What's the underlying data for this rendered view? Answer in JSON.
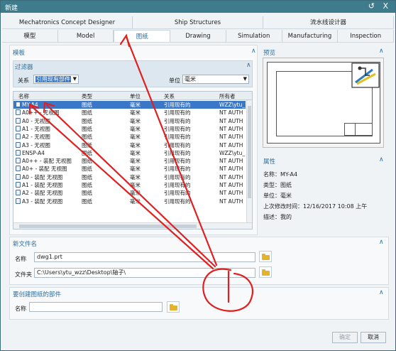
{
  "window": {
    "title": "新建",
    "controls": "↺ X"
  },
  "app_tabs": [
    "Mechatronics Concept Designer",
    "Ship Structures",
    "流水线设计器"
  ],
  "tabs": [
    {
      "label": "模型",
      "active": false
    },
    {
      "label": "Model",
      "active": false
    },
    {
      "label": "图纸",
      "active": true
    },
    {
      "label": "Drawing",
      "active": false
    },
    {
      "label": "Simulation",
      "active": false
    },
    {
      "label": "Manufacturing",
      "active": false
    },
    {
      "label": "Inspection",
      "active": false
    }
  ],
  "templates": {
    "title": "模板",
    "filter_title": "过滤器",
    "relation_label": "关系",
    "relation_value": "引用现有部件",
    "unit_label": "单位",
    "unit_value": "毫米",
    "columns": [
      "名称",
      "类型",
      "单位",
      "关系",
      "所有者"
    ],
    "rows": [
      {
        "name": "MY-A4",
        "type": "图纸",
        "unit": "毫米",
        "rel": "引用现有的",
        "owner": "WZZ\\ytu_"
      },
      {
        "name": "A0++ - 无视图",
        "type": "图纸",
        "unit": "毫米",
        "rel": "引用现有的",
        "owner": "NT AUTH"
      },
      {
        "name": "A0 - 无视图",
        "type": "图纸",
        "unit": "毫米",
        "rel": "引用现有的",
        "owner": "NT AUTH"
      },
      {
        "name": "A1 - 无视图",
        "type": "图纸",
        "unit": "毫米",
        "rel": "引用现有的",
        "owner": "NT AUTH"
      },
      {
        "name": "A2 - 无视图",
        "type": "图纸",
        "unit": "毫米",
        "rel": "引用现有的",
        "owner": "NT AUTH"
      },
      {
        "name": "A3 - 无视图",
        "type": "图纸",
        "unit": "毫米",
        "rel": "引用现有的",
        "owner": "NT AUTH"
      },
      {
        "name": "ENSP-A4",
        "type": "图纸",
        "unit": "毫米",
        "rel": "引用现有的",
        "owner": "WZZ\\ytu_"
      },
      {
        "name": "A0++ - 装配 无视图",
        "type": "图纸",
        "unit": "毫米",
        "rel": "引用现有的",
        "owner": "NT AUTH"
      },
      {
        "name": "A0+ - 装配 无视图",
        "type": "图纸",
        "unit": "毫米",
        "rel": "引用现有的",
        "owner": "NT AUTH"
      },
      {
        "name": "A0 - 装配 无视图",
        "type": "图纸",
        "unit": "毫米",
        "rel": "引用现有的",
        "owner": "NT AUTH"
      },
      {
        "name": "A1 - 装配 无视图",
        "type": "图纸",
        "unit": "毫米",
        "rel": "引用现有的",
        "owner": "NT AUTH"
      },
      {
        "name": "A2 - 装配 无视图",
        "type": "图纸",
        "unit": "毫米",
        "rel": "引用现有的",
        "owner": "NT AUTH"
      },
      {
        "name": "A3 - 装配 无视图",
        "type": "图纸",
        "unit": "毫米",
        "rel": "引用现有的",
        "owner": "NT AUTH"
      }
    ]
  },
  "preview": {
    "title": "预览"
  },
  "properties": {
    "title": "属性",
    "name": "名称：MY-A4",
    "type": "类型：图纸",
    "unit": "单位：毫米",
    "modified": "上次修改时间：12/16/2017 10:08 上午",
    "desc": "描述：我的"
  },
  "new_file": {
    "title": "新文件名",
    "name_label": "名称",
    "name_value": "dwg1.prt",
    "folder_label": "文件夹",
    "folder_value": "C:\\Users\\ytu_wzz\\Desktop\\轴子\\"
  },
  "part": {
    "title": "要创建图纸的部件",
    "name_label": "名称",
    "name_value": ""
  },
  "buttons": {
    "ok": "确定",
    "cancel": "取消"
  },
  "annotation_color": "#e02020"
}
